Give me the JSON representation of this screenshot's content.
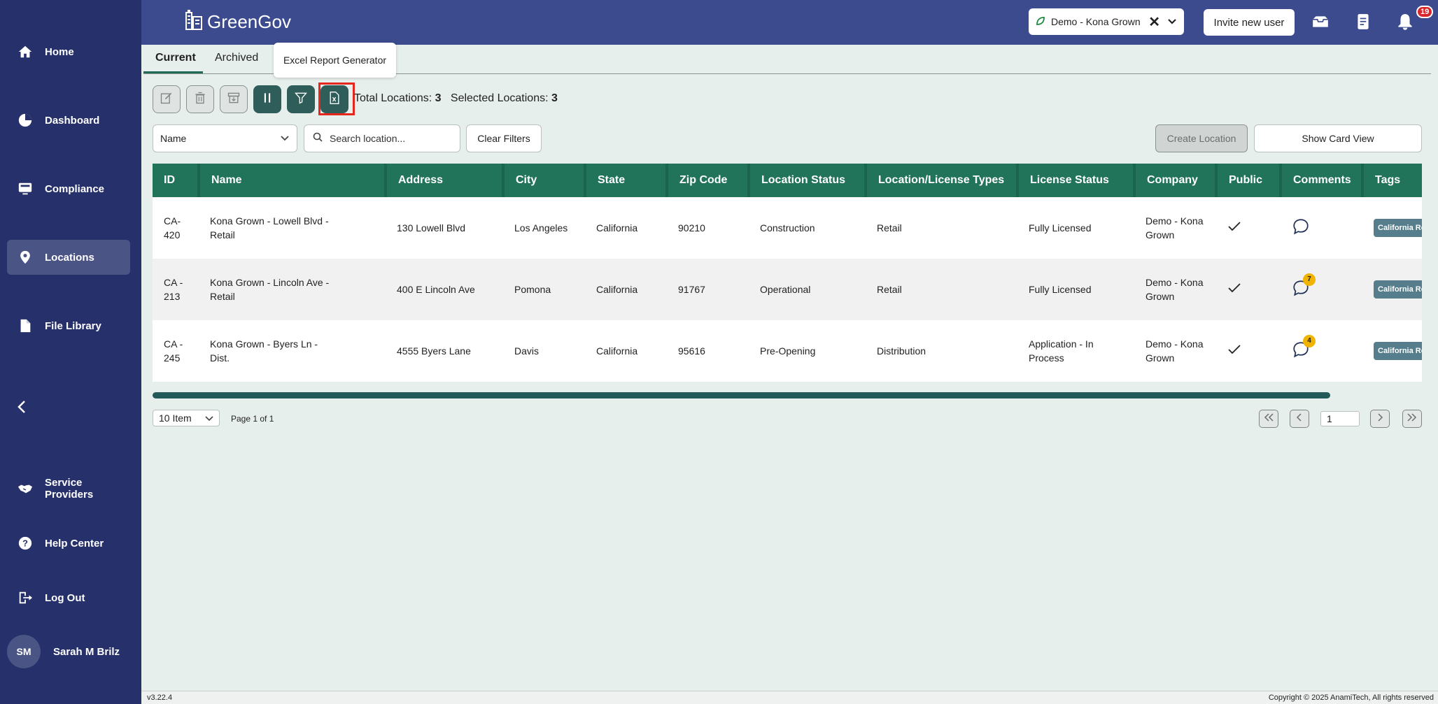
{
  "sidebar": {
    "items": [
      {
        "label": "Home",
        "icon": "home-icon"
      },
      {
        "label": "Dashboard",
        "icon": "pie-chart-icon"
      },
      {
        "label": "Compliance",
        "icon": "monitor-icon"
      },
      {
        "label": "Locations",
        "icon": "map-pin-icon"
      },
      {
        "label": "File Library",
        "icon": "document-icon"
      },
      {
        "label": "Service Providers",
        "icon": "handshake-icon"
      },
      {
        "label": "Help Center",
        "icon": "help-icon"
      },
      {
        "label": "Log Out",
        "icon": "logout-icon"
      }
    ],
    "user": {
      "initials": "SM",
      "name": "Sarah M Brilz"
    }
  },
  "header": {
    "brand": "GreenGov",
    "org": "Demo - Kona Grown",
    "invite_label": "Invite new user",
    "notification_count": "19"
  },
  "tabs": [
    {
      "label": "Current"
    },
    {
      "label": "Archived"
    }
  ],
  "tooltip": "Excel Report Generator",
  "toolbar": {
    "total_label": "Total Locations:",
    "total_value": "3",
    "selected_label": "Selected Locations:",
    "selected_value": "3"
  },
  "filters": {
    "sort_selected": "Name",
    "search_placeholder": "Search location...",
    "clear_label": "Clear Filters",
    "create_label": "Create Location",
    "card_view_label": "Show Card View"
  },
  "table": {
    "columns": [
      "ID",
      "Name",
      "Address",
      "City",
      "State",
      "Zip Code",
      "Location Status",
      "Location/License Types",
      "License Status",
      "Company",
      "Public",
      "Comments",
      "Tags"
    ],
    "rows": [
      {
        "id": "CA-420",
        "name": "Kona Grown - Lowell Blvd - Retail",
        "address": "130 Lowell Blvd",
        "city": "Los Angeles",
        "state": "California",
        "zip": "90210",
        "status": "Construction",
        "type": "Retail",
        "license": "Fully Licensed",
        "company": "Demo - Kona Grown",
        "comments": "",
        "tag": "California Retail"
      },
      {
        "id": "CA - 213",
        "name": "Kona Grown - Lincoln Ave - Retail",
        "address": "400 E Lincoln Ave",
        "city": "Pomona",
        "state": "California",
        "zip": "91767",
        "status": "Operational",
        "type": "Retail",
        "license": "Fully Licensed",
        "company": "Demo - Kona Grown",
        "comments": "7",
        "tag": "California Retail"
      },
      {
        "id": "CA - 245",
        "name": "Kona Grown - Byers Ln - Dist.",
        "address": "4555 Byers Lane",
        "city": "Davis",
        "state": "California",
        "zip": "95616",
        "status": "Pre-Opening",
        "type": "Distribution",
        "license": "Application - In Process",
        "company": "Demo - Kona Grown",
        "comments": "4",
        "tag": "California Retail"
      }
    ]
  },
  "pagination": {
    "per_page": "10 Item",
    "page_info": "Page 1 of 1",
    "current_page": "1"
  },
  "footer": {
    "version": "v3.22.4",
    "copyright": "Copyright © 2025 AnamiTech, All rights reserved"
  }
}
